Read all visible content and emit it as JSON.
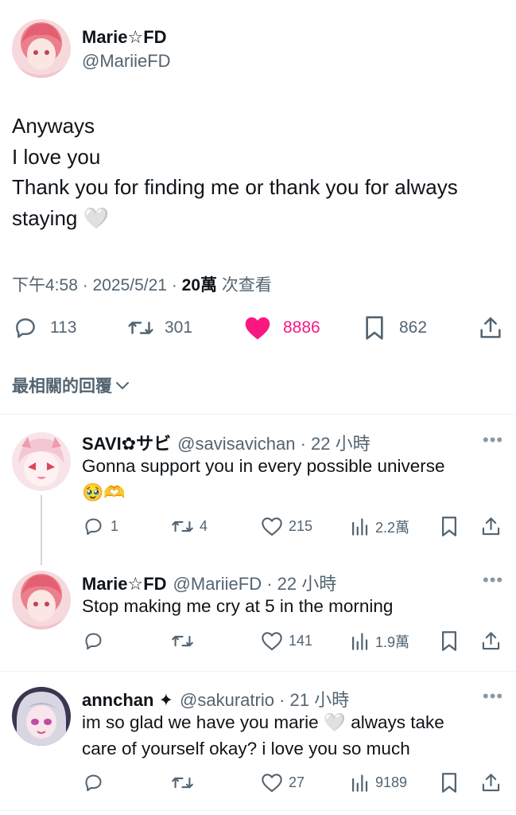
{
  "main_post": {
    "author_name": "Marie☆FD",
    "author_handle": "@MariieFD",
    "lines": [
      "Anyways",
      "I love you",
      "Thank you for finding me or thank you for always",
      "staying"
    ],
    "emoji_after": "🤍",
    "time": "下午4:58",
    "date": "2025/5/21",
    "views_count": "20萬",
    "views_label": "次查看",
    "replies": "113",
    "reposts": "301",
    "likes": "8886",
    "bookmarks": "862",
    "like_color": "#f91880"
  },
  "sort_label": "最相關的回覆",
  "replies": [
    {
      "name": "SAVI✿サビ",
      "handle": "@savisavichan",
      "age": "22 小時",
      "text": "Gonna support you in every possible universe",
      "emoji_line": "🥹🫶",
      "replies": "1",
      "reposts": "4",
      "likes": "215",
      "views": "2.2萬"
    },
    {
      "name": "Marie☆FD",
      "handle": "@MariieFD",
      "age": "22 小時",
      "text": "Stop making me cry at 5 in the morning",
      "replies": "",
      "reposts": "",
      "likes": "141",
      "views": "1.9萬"
    },
    {
      "name": "annchan ✦",
      "handle": "@sakuratrio",
      "age": "21 小時",
      "text_line1": "im so glad we have you marie",
      "text_emoji": "🤍",
      "text_line1b": "always take",
      "text_line2": "care of yourself okay? i love you so much",
      "replies": "",
      "reposts": "",
      "likes": "27",
      "views": "9189"
    }
  ],
  "colors": {
    "text": "#0f1419",
    "secondary": "#536471",
    "like": "#f91880"
  }
}
